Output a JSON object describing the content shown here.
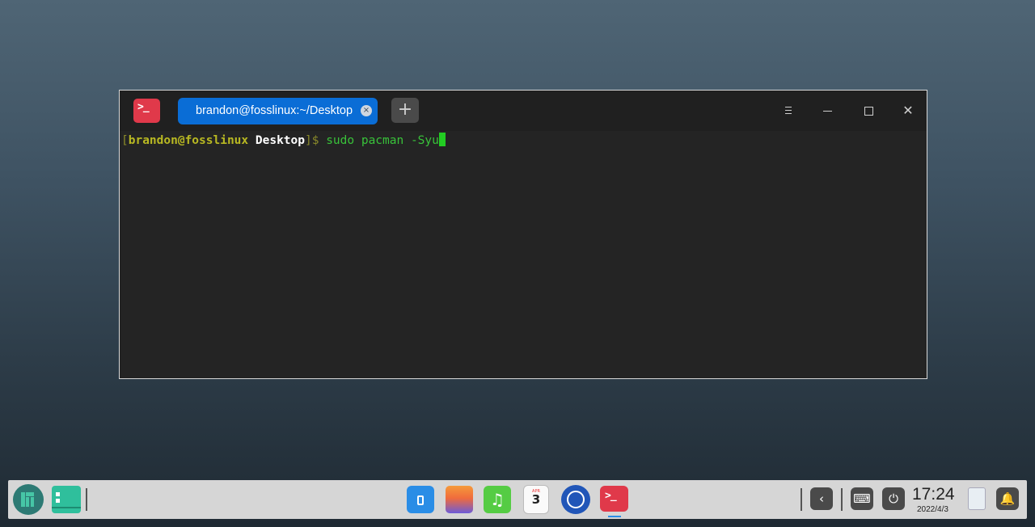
{
  "terminal": {
    "tab_title": "brandon@fosslinux:~/Desktop",
    "tab_close": "×",
    "new_tab": "+",
    "app_icon_glyph": ">_",
    "prompt": {
      "open_bracket": "[",
      "user_host": "brandon@fosslinux",
      "directory": "Desktop",
      "close_bracket": "]$",
      "command": "sudo pacman -Syu"
    },
    "controls": {
      "close_glyph": "✕"
    }
  },
  "dock": {
    "launcher_icon": "manjaro-logo-icon",
    "apps": [
      {
        "name": "app-store-icon"
      },
      {
        "name": "photos-icon"
      },
      {
        "name": "music-icon",
        "glyph": "♫"
      },
      {
        "name": "calendar-icon",
        "month": "APR",
        "day": "3"
      },
      {
        "name": "settings-icon"
      },
      {
        "name": "terminal-icon",
        "glyph": ">_"
      }
    ],
    "tray": {
      "back_glyph": "‹",
      "keyboard_glyph": "⌨",
      "power_glyph": "⏻",
      "bell_glyph": "🔔"
    },
    "clock": {
      "time": "17:24",
      "date": "2022/4/3"
    }
  },
  "colors": {
    "terminal_red": "#e0394a",
    "tab_blue": "#0a6dd6",
    "prompt_green": "#39c23a",
    "prompt_yellow": "#b8b822"
  }
}
